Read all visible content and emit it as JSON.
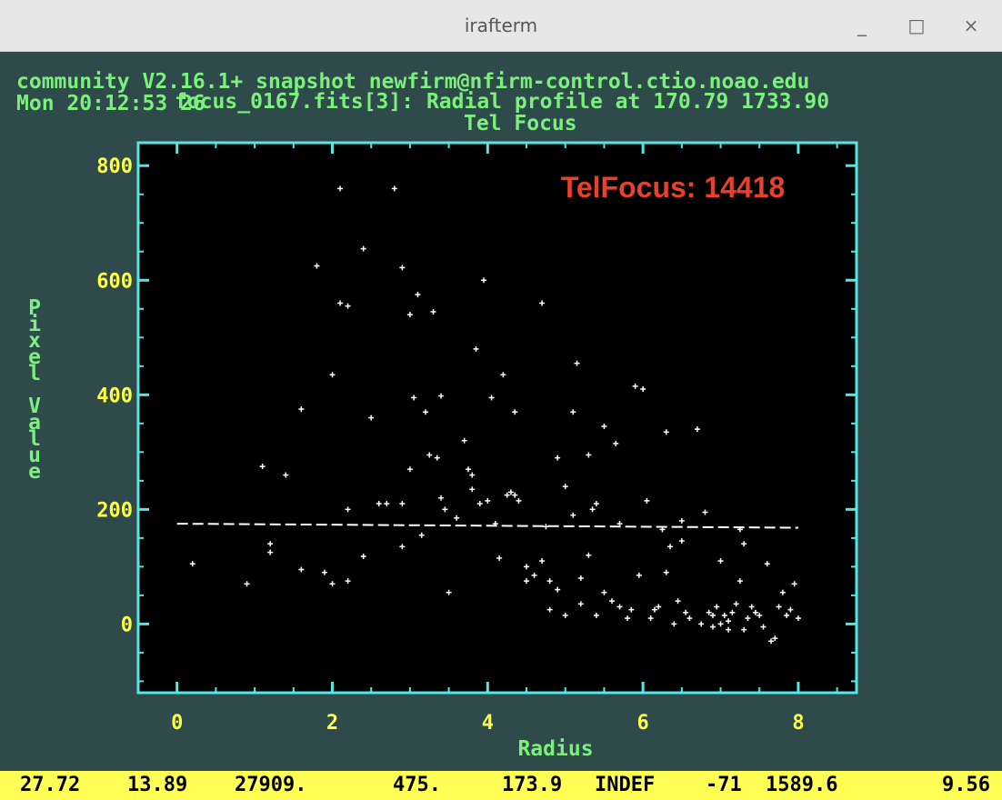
{
  "window": {
    "title": "irafterm",
    "minimize": "_",
    "maximize": "□",
    "close": "×"
  },
  "terminal": {
    "line1": "community V2.16.1+ snapshot newfirm@nfirm-control.ctio.noao.edu",
    "line2": "Mon 20:12:53 26",
    "plot_header": "focus_0167.fits[3]: Radial profile at 170.79 1733.90",
    "plot_title": "Tel Focus"
  },
  "annotation": {
    "text": "TelFocus: 14418",
    "color": "#e8402a"
  },
  "colors": {
    "axis": "#55e6e6",
    "tick_label": "#ffff44",
    "label": "#7cf07c",
    "points": "#ffffff",
    "plot_bg": "#000000",
    "term_bg": "#2f4a4a",
    "status_bg": "#ffff55"
  },
  "chart_data": {
    "type": "scatter",
    "xlabel": "Radius",
    "ylabel": "Pixel Value",
    "xlim": [
      -0.5,
      8.75
    ],
    "ylim": [
      -120,
      840
    ],
    "x_ticks": [
      "0",
      "2",
      "4",
      "6",
      "8"
    ],
    "x_tick_values": [
      0,
      2,
      4,
      6,
      8
    ],
    "y_ticks": [
      "0",
      "200",
      "400",
      "600",
      "800"
    ],
    "y_tick_values": [
      0,
      200,
      400,
      600,
      800
    ],
    "fit_line": {
      "x": [
        0,
        8
      ],
      "y": [
        175,
        168
      ],
      "style": "dashed"
    },
    "points": [
      [
        0.2,
        105
      ],
      [
        0.9,
        70
      ],
      [
        1.1,
        275
      ],
      [
        1.2,
        140
      ],
      [
        1.2,
        125
      ],
      [
        1.4,
        260
      ],
      [
        1.6,
        95
      ],
      [
        1.6,
        375
      ],
      [
        1.8,
        625
      ],
      [
        1.9,
        90
      ],
      [
        2.0,
        435
      ],
      [
        2.1,
        760
      ],
      [
        2.1,
        560
      ],
      [
        2.0,
        70
      ],
      [
        2.2,
        555
      ],
      [
        2.2,
        200
      ],
      [
        2.2,
        75
      ],
      [
        2.4,
        655
      ],
      [
        2.4,
        118
      ],
      [
        2.5,
        360
      ],
      [
        2.6,
        210
      ],
      [
        2.7,
        210
      ],
      [
        2.8,
        760
      ],
      [
        2.9,
        622
      ],
      [
        2.9,
        210
      ],
      [
        2.9,
        135
      ],
      [
        3.0,
        540
      ],
      [
        3.0,
        270
      ],
      [
        3.05,
        395
      ],
      [
        3.1,
        575
      ],
      [
        3.2,
        370
      ],
      [
        3.15,
        155
      ],
      [
        3.3,
        545
      ],
      [
        3.25,
        295
      ],
      [
        3.35,
        290
      ],
      [
        3.4,
        398
      ],
      [
        3.4,
        220
      ],
      [
        3.45,
        200
      ],
      [
        3.5,
        55
      ],
      [
        3.6,
        185
      ],
      [
        3.7,
        320
      ],
      [
        3.75,
        270
      ],
      [
        3.8,
        260
      ],
      [
        3.8,
        235
      ],
      [
        3.85,
        480
      ],
      [
        3.9,
        210
      ],
      [
        3.95,
        600
      ],
      [
        4.0,
        215
      ],
      [
        4.05,
        395
      ],
      [
        4.1,
        175
      ],
      [
        4.15,
        115
      ],
      [
        4.2,
        435
      ],
      [
        4.25,
        225
      ],
      [
        4.3,
        230
      ],
      [
        4.35,
        370
      ],
      [
        4.35,
        225
      ],
      [
        4.4,
        215
      ],
      [
        4.5,
        100
      ],
      [
        4.5,
        75
      ],
      [
        4.6,
        85
      ],
      [
        4.7,
        560
      ],
      [
        4.7,
        110
      ],
      [
        4.75,
        170
      ],
      [
        4.8,
        25
      ],
      [
        4.8,
        75
      ],
      [
        4.9,
        60
      ],
      [
        4.9,
        290
      ],
      [
        5.0,
        240
      ],
      [
        5.0,
        15
      ],
      [
        5.1,
        370
      ],
      [
        5.1,
        190
      ],
      [
        5.15,
        455
      ],
      [
        5.2,
        80
      ],
      [
        5.2,
        35
      ],
      [
        5.3,
        295
      ],
      [
        5.3,
        120
      ],
      [
        5.35,
        200
      ],
      [
        5.4,
        210
      ],
      [
        5.4,
        15
      ],
      [
        5.5,
        345
      ],
      [
        5.5,
        55
      ],
      [
        5.6,
        40
      ],
      [
        5.65,
        315
      ],
      [
        5.7,
        30
      ],
      [
        5.7,
        175
      ],
      [
        5.8,
        10
      ],
      [
        5.85,
        25
      ],
      [
        5.9,
        415
      ],
      [
        5.95,
        85
      ],
      [
        6.0,
        410
      ],
      [
        6.05,
        215
      ],
      [
        6.1,
        10
      ],
      [
        6.15,
        25
      ],
      [
        6.2,
        30
      ],
      [
        6.25,
        165
      ],
      [
        6.3,
        335
      ],
      [
        6.3,
        90
      ],
      [
        6.35,
        135
      ],
      [
        6.4,
        0
      ],
      [
        6.45,
        40
      ],
      [
        6.5,
        180
      ],
      [
        6.5,
        145
      ],
      [
        6.55,
        20
      ],
      [
        6.6,
        10
      ],
      [
        6.7,
        340
      ],
      [
        6.75,
        0
      ],
      [
        6.8,
        195
      ],
      [
        6.85,
        20
      ],
      [
        6.9,
        -5
      ],
      [
        6.95,
        30
      ],
      [
        7.0,
        110
      ],
      [
        7.05,
        15
      ],
      [
        7.1,
        -10
      ],
      [
        7.15,
        20
      ],
      [
        7.2,
        35
      ],
      [
        7.25,
        165
      ],
      [
        7.25,
        75
      ],
      [
        7.3,
        140
      ],
      [
        7.35,
        10
      ],
      [
        7.4,
        30
      ],
      [
        7.45,
        20
      ],
      [
        7.5,
        15
      ],
      [
        7.55,
        -5
      ],
      [
        7.6,
        105
      ],
      [
        7.65,
        -30
      ],
      [
        7.7,
        -25
      ],
      [
        7.75,
        30
      ],
      [
        7.8,
        55
      ],
      [
        7.85,
        15
      ],
      [
        7.9,
        25
      ],
      [
        7.95,
        70
      ],
      [
        8.0,
        10
      ],
      [
        7.0,
        0
      ],
      [
        7.3,
        -10
      ],
      [
        6.9,
        15
      ],
      [
        7.1,
        5
      ]
    ]
  },
  "status": {
    "values": [
      "27.72",
      "13.89",
      "27909.",
      "475.",
      "173.9",
      "INDEF",
      "-71",
      "1589.6",
      "9.56"
    ]
  }
}
